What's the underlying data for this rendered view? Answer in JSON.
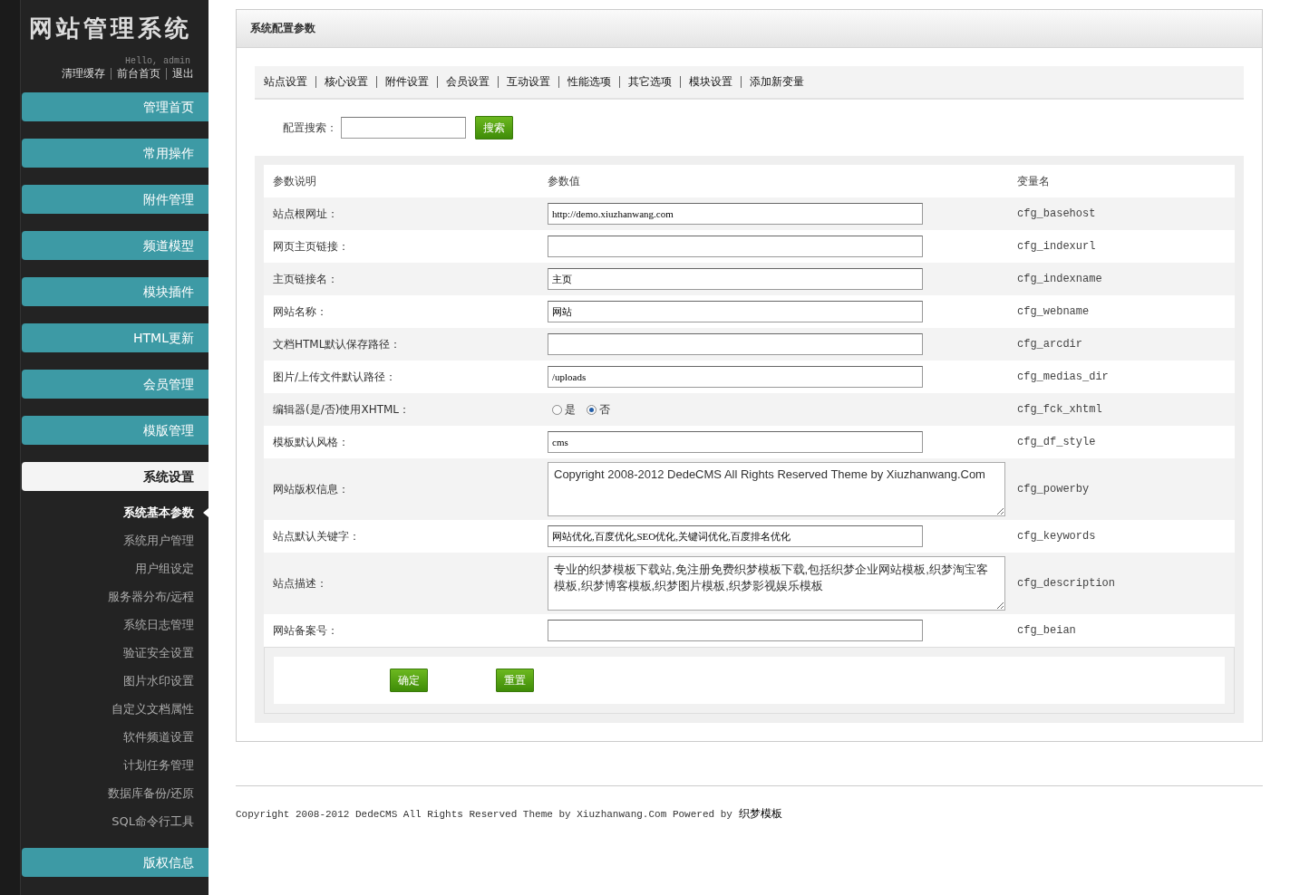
{
  "sidebar": {
    "title": "网站管理系统",
    "greeting": "Hello, admin",
    "links": [
      "清理缓存",
      "前台首页",
      "退出"
    ],
    "menu": [
      {
        "label": "管理首页",
        "selected": false
      },
      {
        "label": "常用操作",
        "selected": false
      },
      {
        "label": "附件管理",
        "selected": false
      },
      {
        "label": "频道模型",
        "selected": false
      },
      {
        "label": "模块插件",
        "selected": false
      },
      {
        "label": "HTML更新",
        "selected": false
      },
      {
        "label": "会员管理",
        "selected": false
      },
      {
        "label": "模版管理",
        "selected": false
      },
      {
        "label": "系统设置",
        "selected": true,
        "children": [
          {
            "label": "系统基本参数",
            "selected": true
          },
          {
            "label": "系统用户管理",
            "selected": false
          },
          {
            "label": "用户组设定",
            "selected": false
          },
          {
            "label": "服务器分布/远程",
            "selected": false
          },
          {
            "label": "系统日志管理",
            "selected": false
          },
          {
            "label": "验证安全设置",
            "selected": false
          },
          {
            "label": "图片水印设置",
            "selected": false
          },
          {
            "label": "自定义文档属性",
            "selected": false
          },
          {
            "label": "软件频道设置",
            "selected": false
          },
          {
            "label": "计划任务管理",
            "selected": false
          },
          {
            "label": "数据库备份/还原",
            "selected": false
          },
          {
            "label": "SQL命令行工具",
            "selected": false
          }
        ]
      },
      {
        "label": "版权信息",
        "selected": false
      }
    ]
  },
  "panel": {
    "title": "系统配置参数",
    "tabs": [
      "站点设置",
      "核心设置",
      "附件设置",
      "会员设置",
      "互动设置",
      "性能选项",
      "其它选项",
      "模块设置",
      "添加新变量"
    ],
    "search": {
      "label": "配置搜索：",
      "button": "搜索"
    },
    "table": {
      "columns": [
        "参数说明",
        "参数值",
        "变量名"
      ],
      "rows": [
        {
          "kind": "text",
          "label": "站点根网址：",
          "value": "http://demo.xiuzhanwang.com",
          "var": "cfg_basehost"
        },
        {
          "kind": "text",
          "label": "网页主页链接：",
          "value": "",
          "var": "cfg_indexurl"
        },
        {
          "kind": "text",
          "label": "主页链接名：",
          "value": "主页",
          "var": "cfg_indexname"
        },
        {
          "kind": "text",
          "label": "网站名称：",
          "value": "网站",
          "var": "cfg_webname"
        },
        {
          "kind": "text",
          "label": "文档HTML默认保存路径：",
          "value": "",
          "var": "cfg_arcdir"
        },
        {
          "kind": "text",
          "label": "图片/上传文件默认路径：",
          "value": "/uploads",
          "var": "cfg_medias_dir"
        },
        {
          "kind": "radio",
          "label": "编辑器(是/否)使用XHTML：",
          "options": [
            {
              "label": "是",
              "selected": false
            },
            {
              "label": "否",
              "selected": true
            }
          ],
          "var": "cfg_fck_xhtml"
        },
        {
          "kind": "text",
          "label": "模板默认风格：",
          "value": "cms",
          "var": "cfg_df_style"
        },
        {
          "kind": "textarea",
          "label": "网站版权信息：",
          "value": "Copyright 2008-2012 DedeCMS All Rights Reserved Theme by Xiuzhanwang.Com",
          "var": "cfg_powerby"
        },
        {
          "kind": "text",
          "label": "站点默认关键字：",
          "value": "网站优化,百度优化,SEO优化,关键词优化,百度排名优化",
          "var": "cfg_keywords"
        },
        {
          "kind": "textarea",
          "label": "站点描述：",
          "value": "专业的织梦模板下载站,免注册免费织梦模板下载,包括织梦企业网站模板,织梦淘宝客模板,织梦博客模板,织梦图片模板,织梦影视娱乐模板",
          "var": "cfg_description"
        },
        {
          "kind": "text",
          "label": "网站备案号：",
          "value": "",
          "var": "cfg_beian"
        }
      ]
    },
    "buttons": [
      "确定",
      "重置"
    ]
  },
  "footer": {
    "text": "Copyright 2008-2012 DedeCMS All Rights Reserved Theme by Xiuzhanwang.Com Powered by",
    "link": "织梦模板"
  }
}
